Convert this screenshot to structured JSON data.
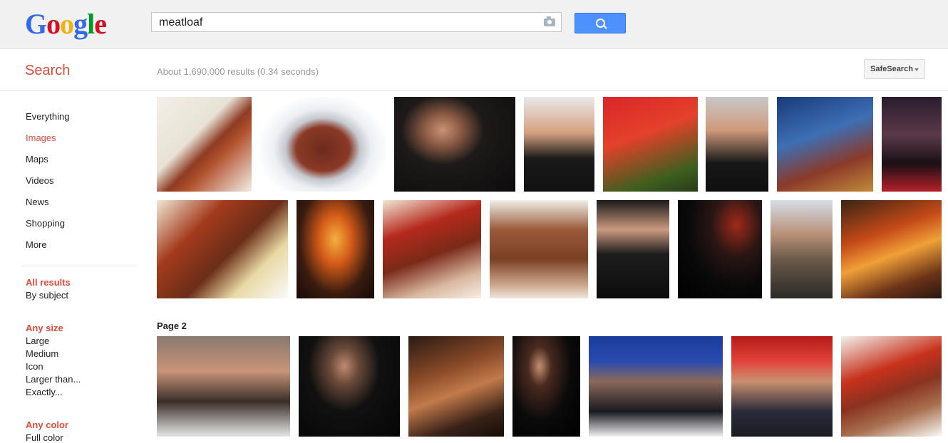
{
  "logo": {
    "letters": [
      "G",
      "o",
      "o",
      "g",
      "l",
      "e"
    ],
    "colors": [
      "#3369e8",
      "#d50f25",
      "#eeb211",
      "#3369e8",
      "#009925",
      "#d50f25"
    ]
  },
  "search": {
    "query": "meatloaf",
    "button_icon": "search-icon",
    "camera_icon": "camera-icon"
  },
  "subheader": {
    "title": "Search",
    "stats": "About 1,690,000 results (0.34 seconds)",
    "safesearch": "SafeSearch"
  },
  "nav": {
    "items": [
      "Everything",
      "Images",
      "Maps",
      "Videos",
      "News",
      "Shopping",
      "More"
    ],
    "active": "Images"
  },
  "tools": {
    "results": {
      "selected": "All results",
      "other": "By subject"
    },
    "size": {
      "selected": "Any size",
      "options": [
        "Large",
        "Medium",
        "Icon",
        "Larger than...",
        "Exactly..."
      ]
    },
    "color": {
      "selected": "Any color",
      "options": [
        "Full color"
      ]
    }
  },
  "page2_label": "Page 2",
  "colors": {
    "accent_red": "#dd4b39",
    "button_blue": "#4d90fe"
  },
  "images": {
    "row1": [
      {
        "subject": "meatloaf plate",
        "bg": "linear-gradient(135deg,#f4efe8 0%,#e8e2d6 40%,#8e3b22 55%,#b2522e 65%,#f2eee6 100%)"
      },
      {
        "subject": "sliced meatloaf on platter",
        "bg": "radial-gradient(ellipse at 50% 55%,#6e2a1d 0%,#8a3a26 30%,#c4c8cf 42%,#eceff3 55%,#ffffff 75%)"
      },
      {
        "subject": "Meat Loaf portrait",
        "bg": "radial-gradient(ellipse at 40% 35%,#c89374 0%,#8a5a44 18%,#1d1a19 40%,#0d0c0c 100%)"
      },
      {
        "subject": "Meat Loaf smiling",
        "bg": "linear-gradient(180deg,#e8e8ea 0%,#d6a080 38%,#1a1a1a 65%,#111 100%)"
      },
      {
        "subject": "Bat Out of Hell album",
        "bg": "linear-gradient(160deg,#d9262a 0%,#e4412a 40%,#3c5f1e 80%,#2a3a1a 100%)"
      },
      {
        "subject": "Meat Loaf headshot",
        "bg": "linear-gradient(180deg,#c8c8c8 0%,#d09a7c 35%,#171717 70%,#0f0f0f 100%)"
      },
      {
        "subject": "Bat Out of Hell II album",
        "bg": "linear-gradient(160deg,#1a3a7a 0%,#3d6fb4 40%,#8a3a2a 70%,#c28a3a 100%)"
      },
      {
        "subject": "Meat Loaf on stage",
        "bg": "linear-gradient(180deg,#2b1c2e 0%,#5a3a4a 40%,#1a1015 70%,#b4202a 100%)"
      }
    ],
    "row2": [
      {
        "subject": "meatloaf with vegetables",
        "bg": "linear-gradient(135deg,#efe8d6 0%,#a33a1c 30%,#6b2e18 55%,#e8d9a4 75%,#fafafa 100%)"
      },
      {
        "subject": "Meat Loaf in fire",
        "bg": "radial-gradient(ellipse at 50% 40%,#f5b040 0%,#d25a18 30%,#3a1c10 65%,#150a07 100%)"
      },
      {
        "subject": "glazed meatloaf",
        "bg": "linear-gradient(160deg,#f2e6d6 0%,#b42a1c 30%,#7a2a18 55%,#d9b8a0 80%,#f8eee4 100%)"
      },
      {
        "subject": "meatloaf slices",
        "bg": "linear-gradient(180deg,#efefe6 0%,#9a5a3a 30%,#7a4024 60%,#c8a286 85%,#efe6dc 100%)"
      },
      {
        "subject": "Meat Loaf singing",
        "bg": "linear-gradient(180deg,#1a1a1a 0%,#cc9a80 30%,#1d1d1d 55%,#0c0c0c 100%)"
      },
      {
        "subject": "Meat Loaf bat backdrop",
        "bg": "radial-gradient(ellipse at 70% 25%,#a12a1a 0%,#2a1614 30%,#090909 60%,#000 100%)"
      },
      {
        "subject": "Meat Loaf outdoors",
        "bg": "linear-gradient(180deg,#d4dde6 0%,#b89077 35%,#6b5a4a 60%,#2c2a27 100%)"
      },
      {
        "subject": "Meat Loaf album art",
        "bg": "linear-gradient(160deg,#3a2414 0%,#c54a18 35%,#f0a038 55%,#6a3218 80%,#2a1810 100%)"
      }
    ],
    "row3": [
      {
        "subject": "Meat Loaf close-up singing",
        "bg": "linear-gradient(180deg,#8a7a70 0%,#c89478 35%,#3a2e28 65%,#e6e6e6 100%)"
      },
      {
        "subject": "Meat Loaf leaning",
        "bg": "radial-gradient(ellipse at 45% 30%,#c08a70 0%,#6a4a3a 18%,#111 45%,#050505 100%)"
      },
      {
        "subject": "Meat Loaf duet",
        "bg": "linear-gradient(160deg,#2a1a14 0%,#8a4a28 35%,#c27a4a 55%,#3a2218 80%,#150c08 100%)"
      },
      {
        "subject": "Meat Loaf live",
        "bg": "radial-gradient(ellipse at 40% 30%,#c49070 0%,#4a2a20 20%,#0a0a0a 55%,#000 100%)"
      },
      {
        "subject": "Meat Loaf long hair",
        "bg": "linear-gradient(180deg,#1c3c9a 0%,#2a4ab0 25%,#8a6a5a 45%,#1a1a22 75%,#f0f0f0 100%)"
      },
      {
        "subject": "Meat Loaf red stage",
        "bg": "linear-gradient(180deg,#b41a1a 0%,#e2443a 25%,#c99070 45%,#2a2a3a 75%,#1c1c24 100%)"
      },
      {
        "subject": "meatloaf on plate",
        "bg": "linear-gradient(160deg,#f2f2ee 0%,#c8321c 35%,#8a3220 55%,#a87050 75%,#fafaf6 100%)"
      }
    ]
  }
}
